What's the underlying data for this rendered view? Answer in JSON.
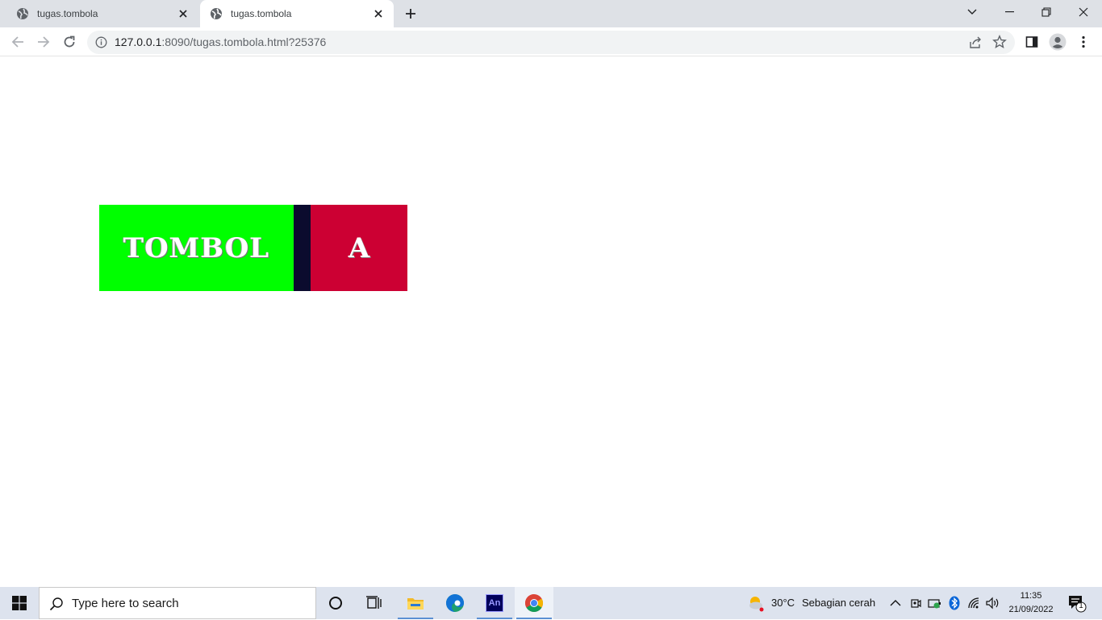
{
  "browser": {
    "tabs": [
      {
        "title": "tugas.tombola",
        "active": false
      },
      {
        "title": "tugas.tombola",
        "active": true
      }
    ],
    "url_host": "127.0.0.1",
    "url_rest": ":8090/tugas.tombola.html?25376"
  },
  "page": {
    "buttons": {
      "tombol_label": "TOMBOL",
      "a_label": "A"
    },
    "colors": {
      "tombol_bg": "#00ff00",
      "separator": "#0b0b2e",
      "a_bg": "#cc0033"
    }
  },
  "taskbar": {
    "search_placeholder": "Type here to search",
    "weather_temp": "30°C",
    "weather_desc": "Sebagian cerah",
    "time": "11:35",
    "date": "21/09/2022",
    "notification_count": "1"
  }
}
